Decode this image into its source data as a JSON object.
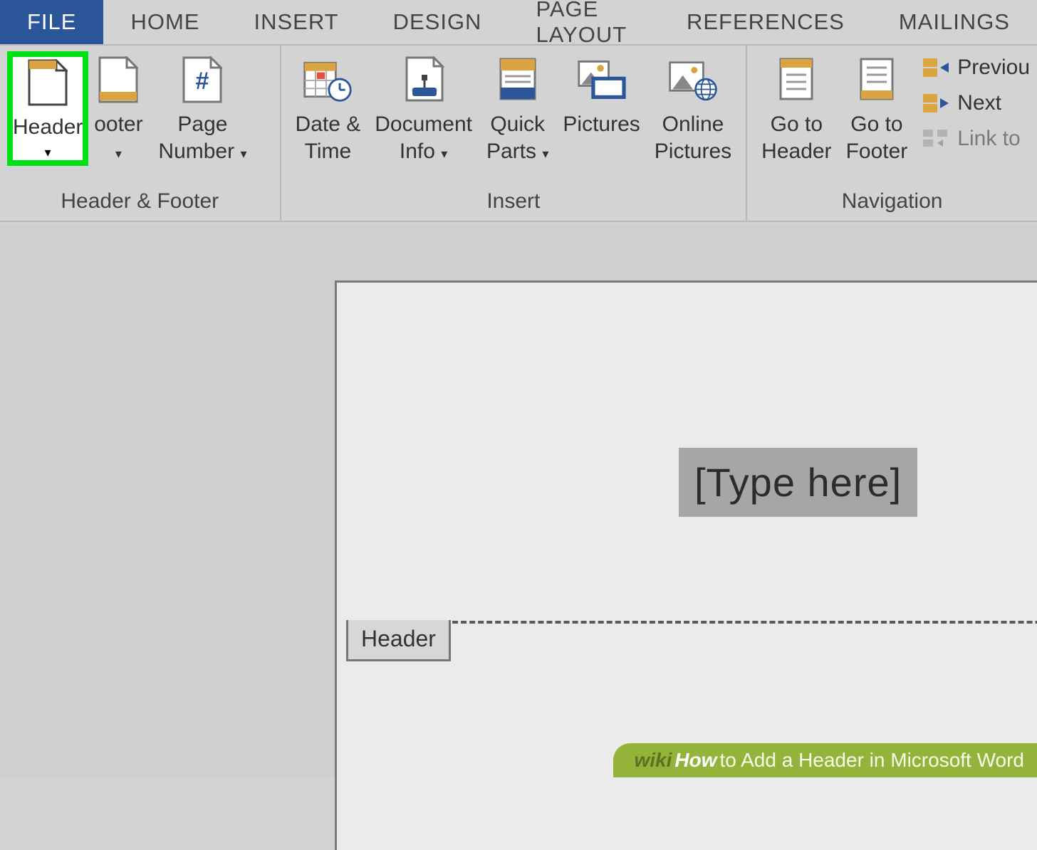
{
  "tabs": {
    "file": "FILE",
    "home": "HOME",
    "insert": "INSERT",
    "design": "DESIGN",
    "page_layout": "PAGE LAYOUT",
    "references": "REFERENCES",
    "mailings": "MAILINGS"
  },
  "ribbon": {
    "groups": {
      "header_footer": {
        "label": "Header & Footer",
        "header_btn": "Header",
        "footer_btn": "ooter",
        "page_number_btn": "Page\nNumber"
      },
      "insert": {
        "label": "Insert",
        "date_time_btn": "Date &\nTime",
        "doc_info_btn": "Document\nInfo",
        "quick_parts_btn": "Quick\nParts",
        "pictures_btn": "Pictures",
        "online_pictures_btn": "Online\nPictures"
      },
      "navigation": {
        "label": "Navigation",
        "goto_header_btn": "Go to\nHeader",
        "goto_footer_btn": "Go to\nFooter",
        "previous_btn": "Previou",
        "next_btn": "Next",
        "link_to_btn": "Link to"
      }
    }
  },
  "document": {
    "placeholder_text": "[Type here]",
    "header_tag": "Header"
  },
  "watermark": {
    "wiki": "wiki",
    "how": "How",
    "title": " to Add a Header in Microsoft Word"
  }
}
